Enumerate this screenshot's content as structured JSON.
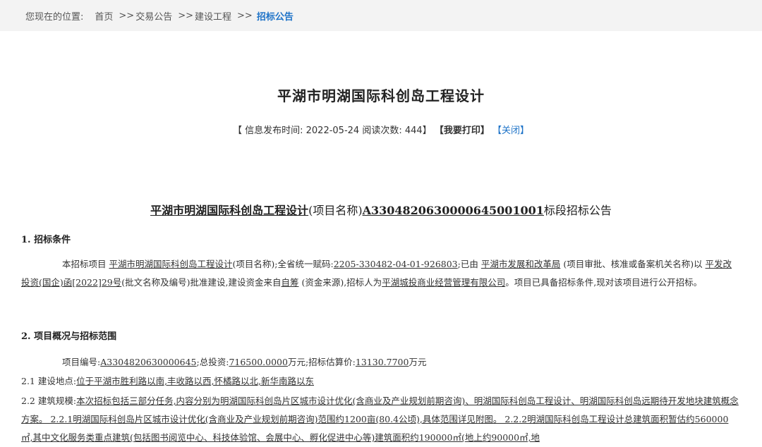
{
  "breadcrumb": {
    "prefix": "您现在的位置:",
    "items": [
      "首页",
      "交易公告",
      "建设工程",
      "招标公告"
    ],
    "separator": ">>"
  },
  "title": "平湖市明湖国际科创岛工程设计",
  "meta": {
    "open": "【",
    "publish_label": "信息发布时间:",
    "publish_date": "2022-05-24",
    "views_label": "阅读次数:",
    "views": "444",
    "close_bracket": "】",
    "print_label": "【我要打印】",
    "close_label": "【关闭】"
  },
  "notice": {
    "project_name": "平湖市明湖国际科创岛工程设计",
    "name_note": "(项目名称)",
    "section_code": "A3304820630000645001001",
    "suffix": "标段招标公告"
  },
  "sections": {
    "s1_title": "1.  招标条件",
    "s1_p1": "本招标项目 ",
    "s1_p1_name": "平湖市明湖国际科创岛工程设计",
    "s1_p2": "(项目名称);全省统一赋码:",
    "s1_p2_code": "2205-330482-04-01-926803",
    "s1_p3": ";已由 ",
    "s1_p3_org": "平湖市发展和改革局",
    "s1_p4": " (项目审批、核准或备案机关名称)以 ",
    "s1_p4_doc": "平发改投资(国企)函[2022]29号",
    "s1_p5": "(批文名称及编号)批准建设,建设资金来自",
    "s1_p5_fund": "自筹",
    "s1_p6": " (资金来源),招标人为",
    "s1_p6_tenderer": "平湖城投商业经营管理有限公司",
    "s1_p7": "。项目已具备招标条件,现对该项目进行公开招标。",
    "s2_title": "2.  项目概况与招标范围",
    "s2_line1_a": "项目编号:",
    "s2_line1_code": "A3304820630000645",
    "s2_line1_b": ";总投资:",
    "s2_line1_invest": "716500.0000",
    "s2_line1_c": "万元;招标估算价:",
    "s2_line1_price": "13130.7700",
    "s2_line1_d": "万元",
    "s2_1_label": "2.1  建设地点:",
    "s2_1_text": "位于平湖市胜利路以南,丰收路以西,怀橘路以北,新华南路以东",
    "s2_2_label": "2.2  建筑规模:",
    "s2_2_text": "本次招标包括三部分任务,内容分别为明湖国际科创岛片区城市设计优化(含商业及产业规划前期咨询)、明湖国际科创岛工程设计、明湖国际科创岛远期待开发地块建筑概念方案。 2.2.1明湖国际科创岛片区城市设计优化(含商业及产业规划前期咨询)范围约1200亩(80.4公顷),具体范围详见附图。 2.2.2明湖国际科创岛工程设计总建筑面积暂估约560000㎡,其中文化服务类重点建筑(包括图书阅览中心、科技体验馆、会展中心、孵化促进中心等)建筑面积约190000㎡(地上约90000㎡,地"
  }
}
